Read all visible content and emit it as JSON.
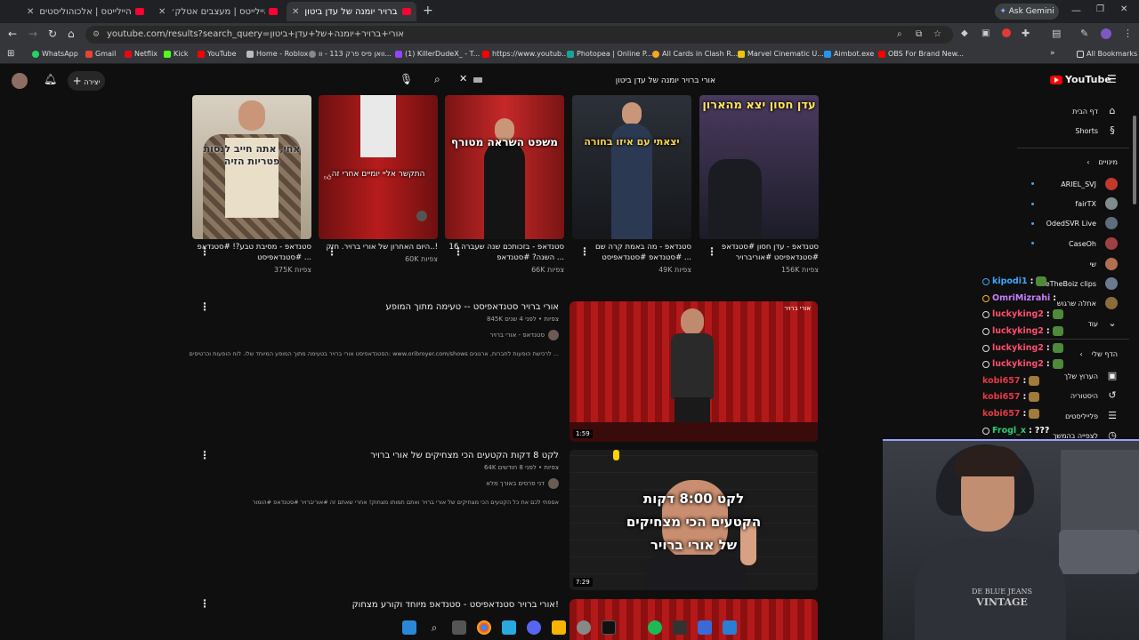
{
  "browser": {
    "tabs": [
      {
        "title": "קיק היילייטס | אלכוהוליסטים",
        "active": false
      },
      {
        "title": "קיק היילייטס | מעצבים אטלק׳",
        "active": false
      },
      {
        "title": "אורי ברויר יומנה של עדן ביטון",
        "active": true
      }
    ],
    "new_tab": "+",
    "ask_gemini": "Ask Gemini",
    "url": "youtube.com/results?search_query=אורי+ברויר+יומנה+של+עדן+ביטון",
    "bookmarks": [
      "WhatsApp",
      "Gmail",
      "Netflix",
      "Kick",
      "YouTube",
      "Home - Roblox",
      "וואן פיס פרק 113 - וו...",
      "(1) KillerDudeX_ - T...",
      "https://www.youtub...",
      "Photopea | Online P...",
      "All Cards in Clash R...",
      "Marvel Cinematic U...",
      "Aimbot.exe",
      "OBS For Brand New..."
    ],
    "all_bookmarks": "All Bookmarks"
  },
  "youtube": {
    "logo": "YouTube",
    "search_query": "אורי ברויר יומנה של עדן ביטון",
    "create_label": "יצירה",
    "shorts": [
      {
        "title": "סטנדאפ - עדן חסון #סטנדאפ #סטנדאפיסט #אוריברויר",
        "views": "156K צפיות",
        "caption": "עדן חסון יצא מהארון",
        "bg": "#2a2a35"
      },
      {
        "title": "סטנדאפ - מה באמת קרה שם #סטנדאפ #סטנדאפיסט ...",
        "views": "49K צפיות",
        "caption": "יצאתי עם איזו בחורה",
        "bg": "#23252b"
      },
      {
        "title": "סטנדאפ - בזכותכם שנה שעברה 16 השנה?  #סטנדאפ ...",
        "views": "66K צפיות",
        "caption": "משפט השראה מטורף",
        "bg": "#9b1c1c"
      },
      {
        "title": "היום האחרון של אורי ברויר. חזק..!",
        "views": "60K צפיות",
        "caption": "התקשר אליי יומיים אחרי זה",
        "bg": "#8e1919"
      },
      {
        "title": "סטנדאפ - מסיבת טבע?! #סטנדאפ #סטנדאפיסט ...",
        "views": "375K צפיות",
        "caption": "אחי, אתה חייב לנסות פטריות הזיה",
        "bg": "#bfae98"
      }
    ],
    "results": [
      {
        "title": "אורי ברויר סטנדאפיסט -- טעימה מתוך המופע",
        "meta": "845K צפיות • לפני 4 שנים",
        "channel": "סטנדאפ - אורי ברויר",
        "description": "הסטנדאפיסט אורי ברויר בטעימה מתוך המופע המיוחד שלו. לוח הופעות וכרטיסים: www.oribroyer.com/shows לרכישת הופעות לחברות, ארגונים ...",
        "duration": "1:59",
        "watermark": "אורי ברויר"
      },
      {
        "title": "לקט 8 דקות הקטעים הכי מצחיקים של אורי ברויר",
        "meta": "64K צפיות • לפני 8 חודשים",
        "channel": "דני פרסים באורך מלא",
        "description": "אספתי לכם את כל הקטעים הכי מצחיקים של אורי ברויר ואתם תמותו מצחוק! אחרי שאתם זה #אוריברויר #סטנדאפ #הומור",
        "duration": "7:29",
        "thumb_text": [
          "לקט 8:00 דקות",
          "הקטעים הכי מצחיקים",
          "של אורי ברויר"
        ]
      },
      {
        "title": "אורי ברויר סטנדאפיסט - סטנדאפ מיוחד וקורע מצחוק!"
      }
    ],
    "sidebar": {
      "home": "דף הבית",
      "shorts": "Shorts",
      "subscriptions_header": "מינויים",
      "subscriptions": [
        {
          "name": "ARIEL_SVJ",
          "color": "#c0392b"
        },
        {
          "name": "fairTX",
          "color": "#7f8c8d"
        },
        {
          "name": "OdedSVR Live",
          "color": "#5d6d7e"
        },
        {
          "name": "CaseOh",
          "color": "#a04040"
        },
        {
          "name": "שי",
          "color": "#b07050"
        },
        {
          "name": "WeTheBoiz clips",
          "color": "#6b7a8f"
        },
        {
          "name": "אחלה שרגוש",
          "color": "#8a6d3b"
        }
      ],
      "more": "עוד",
      "you_header": "הדף שלי",
      "your_channel": "הערוץ שלך",
      "history": "היסטוריה",
      "playlists": "פלייליסטים",
      "watch_later": "לצפייה בהמשך"
    }
  },
  "chat": [
    {
      "user": "kipodi1",
      "color": "#3ea6ff",
      "text": ""
    },
    {
      "user": "OmriMizrahi",
      "color": "#c77dff",
      "text": ""
    },
    {
      "user": "luckyking2",
      "color": "#ff4d6d",
      "text": ""
    },
    {
      "user": "luckyking2",
      "color": "#ff4d6d",
      "text": ""
    },
    {
      "user": "luckyking2",
      "color": "#ff4d6d",
      "text": ""
    },
    {
      "user": "luckyking2",
      "color": "#ff4d6d",
      "text": ""
    },
    {
      "user": "kobi657",
      "color": "#e63946",
      "text": ""
    },
    {
      "user": "kobi657",
      "color": "#e63946",
      "text": ""
    },
    {
      "user": "kobi657",
      "color": "#e63946",
      "text": ""
    },
    {
      "user": "Frogl_x",
      "color": "#2ecc71",
      "text": "???"
    }
  ],
  "webcam": {
    "shirt_text": [
      "DE BLUE JEANS",
      "VINTAGE"
    ]
  }
}
